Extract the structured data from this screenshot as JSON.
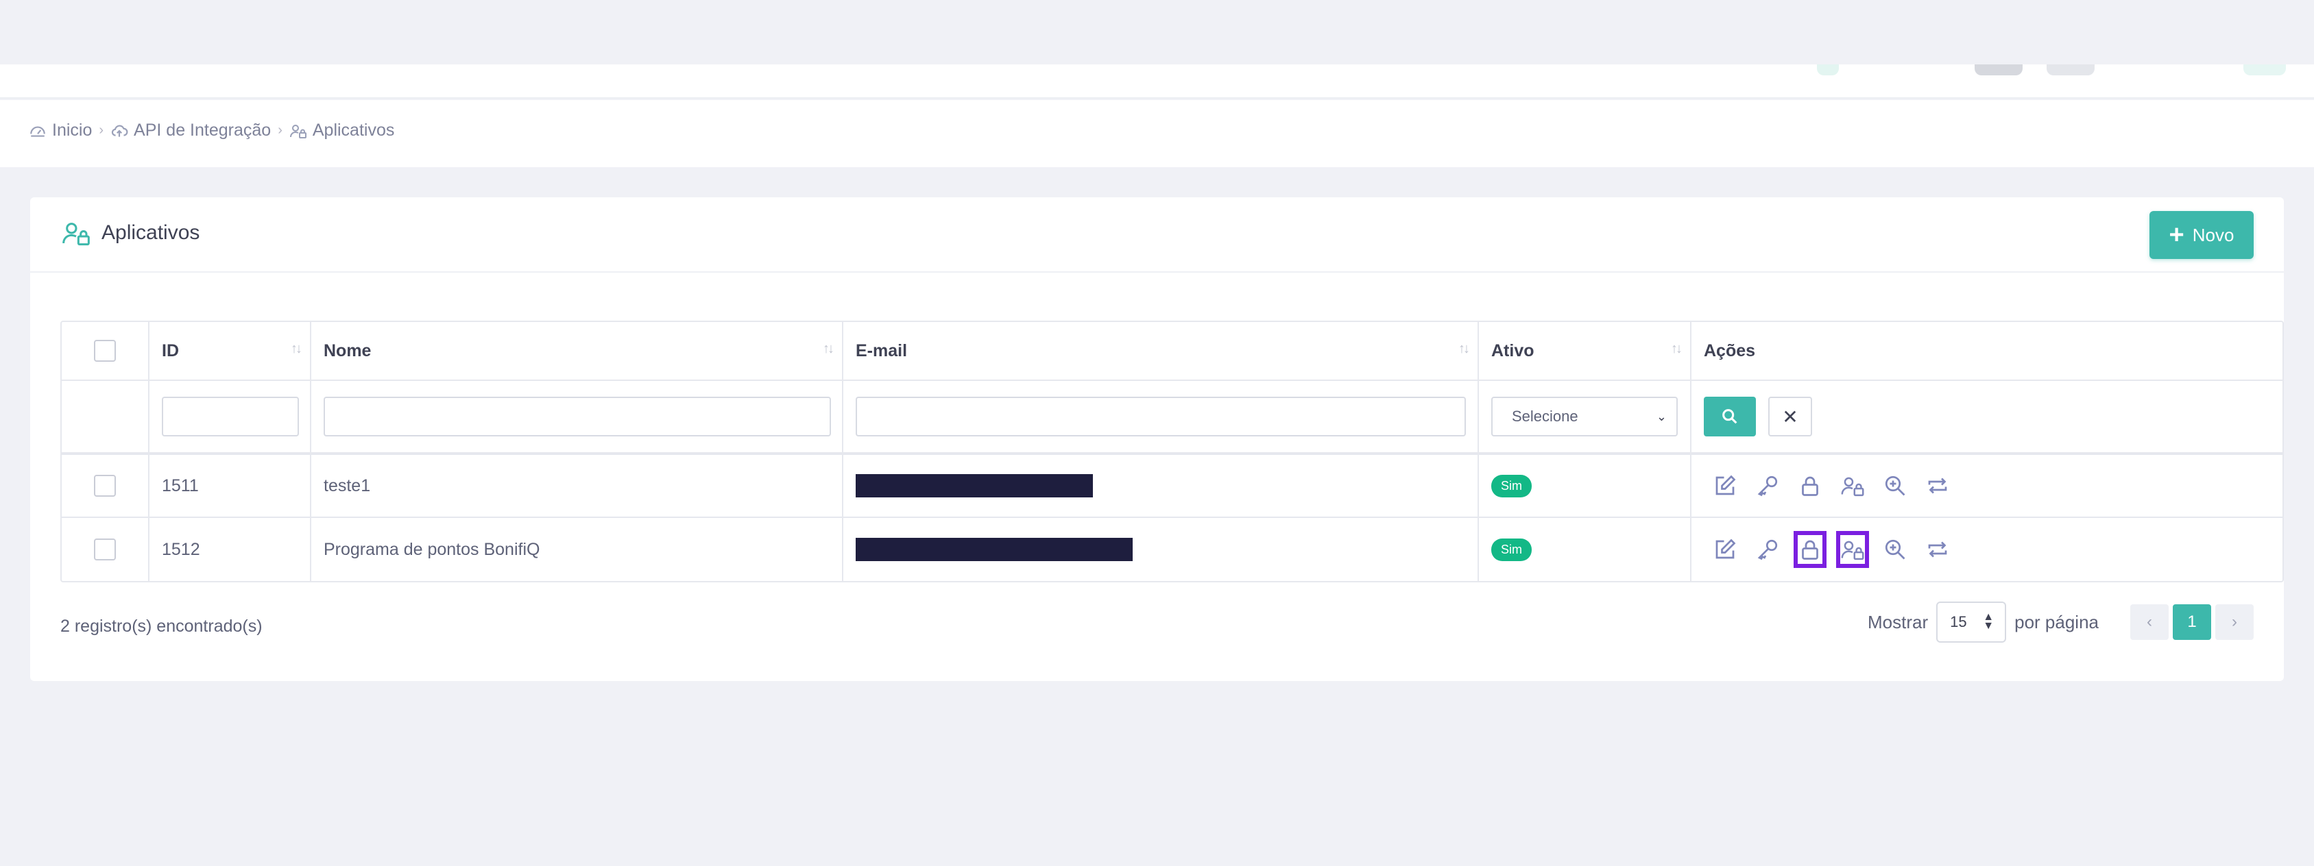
{
  "breadcrumb": {
    "items": [
      {
        "label": "Inicio",
        "icon": "dashboard-icon"
      },
      {
        "label": "API de Integração",
        "icon": "cloud-upload-icon"
      },
      {
        "label": "Aplicativos",
        "icon": "users-lock-icon"
      }
    ],
    "separator": "›"
  },
  "card": {
    "title": "Aplicativos",
    "title_icon": "users-lock-icon",
    "new_button": "Novo"
  },
  "table": {
    "columns": [
      "ID",
      "Nome",
      "E-mail",
      "Ativo",
      "Ações"
    ],
    "filters": {
      "id": "",
      "nome": "",
      "email": "",
      "ativo_selected": "Selecione"
    },
    "rows": [
      {
        "id": "1511",
        "nome": "teste1",
        "email": "",
        "ativo": "Sim"
      },
      {
        "id": "1512",
        "nome": "Programa de pontos BonifiQ",
        "email": "",
        "ativo": "Sim"
      }
    ],
    "row_actions": [
      "edit-icon",
      "key-icon",
      "lock-icon",
      "user-lock-icon",
      "zoom-in-icon",
      "repeat-icon"
    ]
  },
  "footer": {
    "count_text": "2 registro(s) encontrado(s)",
    "show_label": "Mostrar",
    "per_page_value": "15",
    "per_page_suffix": "por página",
    "current_page": "1"
  },
  "colors": {
    "accent": "#3db8ab",
    "badge_green": "#13b886",
    "highlight": "#7b1fe0",
    "redaction": "#1e1e3e",
    "icon": "#7e86bb"
  }
}
